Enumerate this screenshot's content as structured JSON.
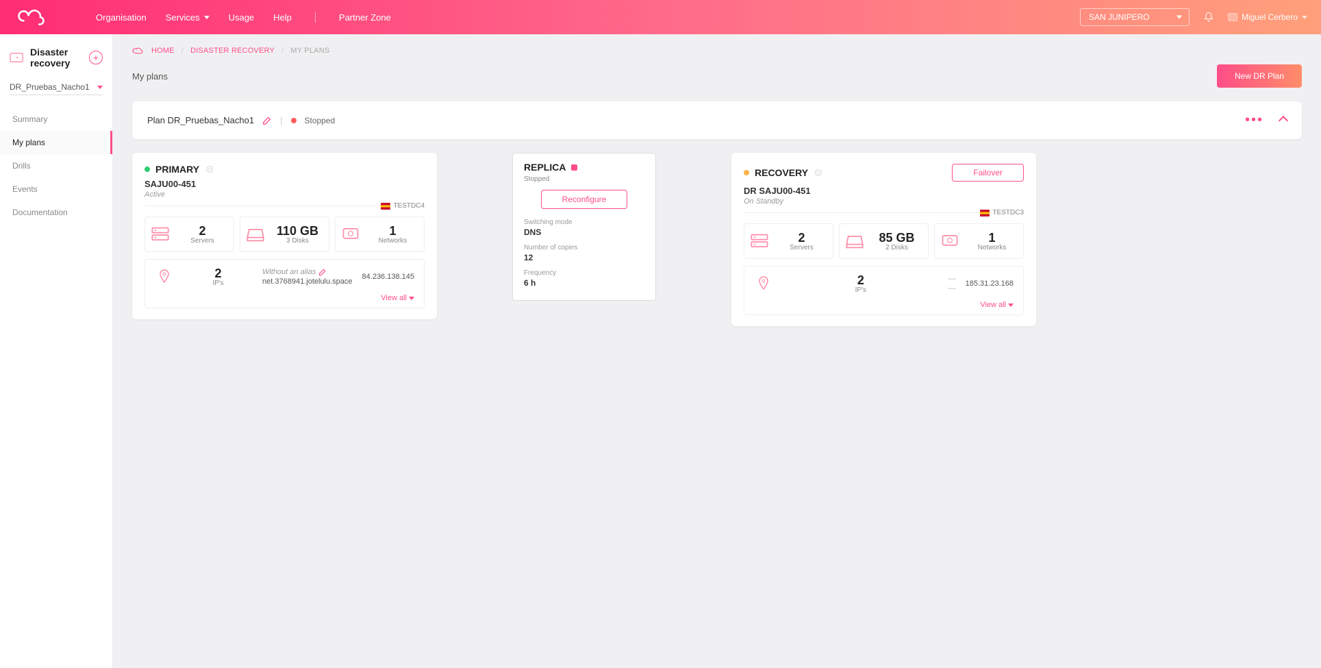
{
  "navbar": {
    "links": {
      "organisation": "Organisation",
      "services": "Services",
      "usage": "Usage",
      "help": "Help",
      "partner_zone": "Partner Zone"
    },
    "org_selected": "SAN JUNIPERO",
    "user_name": "Miguel Cerbero"
  },
  "sidebar": {
    "title": "Disaster recovery",
    "plan_selected": "DR_Pruebas_Nacho1",
    "items": {
      "summary": "Summary",
      "my_plans": "My plans",
      "drills": "Drills",
      "events": "Events",
      "documentation": "Documentation"
    }
  },
  "breadcrumb": {
    "home": "HOME",
    "dr": "DISASTER RECOVERY",
    "current": "MY PLANS"
  },
  "page": {
    "title": "My plans",
    "new_btn": "New DR Plan"
  },
  "plan_bar": {
    "name": "Plan DR_Pruebas_Nacho1",
    "status": "Stopped"
  },
  "primary": {
    "title": "PRIMARY",
    "hostname": "SAJU00-451",
    "status": "Active",
    "dc": "TESTDC4",
    "servers_val": "2",
    "servers_lbl": "Servers",
    "storage_val": "110 GB",
    "storage_lbl": "3 Disks",
    "networks_val": "1",
    "networks_lbl": "Networks",
    "ips_val": "2",
    "ips_lbl": "IP's",
    "alias_note": "Without an alias",
    "hostname_fqdn": "net.3768941.jotelulu.space",
    "ip_addr": "84.236.138.145",
    "view_all": "View all"
  },
  "replica": {
    "title": "REPLICA",
    "status": "Stopped",
    "reconfigure": "Reconfigure",
    "switching_mode_lbl": "Switching mode",
    "switching_mode_val": "DNS",
    "copies_lbl": "Number of copies",
    "copies_val": "12",
    "freq_lbl": "Frequency",
    "freq_val": "6 h"
  },
  "recovery": {
    "title": "RECOVERY",
    "failover": "Failover",
    "hostname": "DR SAJU00-451",
    "status": "On Standby",
    "dc": "TESTDC3",
    "servers_val": "2",
    "servers_lbl": "Servers",
    "storage_val": "85 GB",
    "storage_lbl": "2 Disks",
    "networks_val": "1",
    "networks_lbl": "Networks",
    "ips_val": "2",
    "ips_lbl": "IP's",
    "alias_note": "---",
    "hostname_fqdn": "---",
    "ip_addr": "185.31.23.168",
    "view_all": "View all"
  }
}
